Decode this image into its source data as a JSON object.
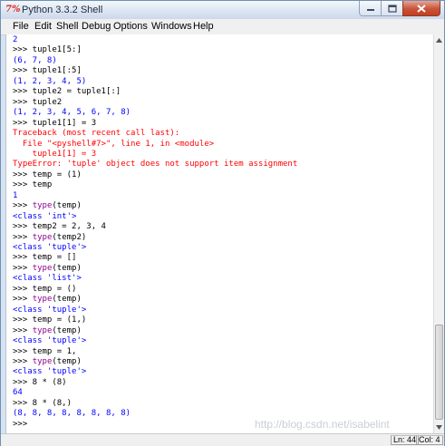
{
  "window": {
    "title": "Python 3.3.2 Shell",
    "icon": "python-idle-icon",
    "icon_glyph": "7%",
    "caption_buttons": [
      "minimize-icon",
      "maximize-icon",
      "close-icon"
    ]
  },
  "menu": [
    "File",
    "Edit",
    "Shell",
    "Debug",
    "Options",
    "Windows",
    "Help"
  ],
  "shell_lines": [
    {
      "text": "2",
      "kind": "out"
    },
    {
      "text": ">>> tuple1[5:]",
      "kind": "in"
    },
    {
      "text": "(6, 7, 8)",
      "kind": "out"
    },
    {
      "text": ">>> tuple1[:5]",
      "kind": "in"
    },
    {
      "text": "(1, 2, 3, 4, 5)",
      "kind": "out"
    },
    {
      "text": ">>> tuple2 = tuple1[:]",
      "kind": "in"
    },
    {
      "text": ">>> tuple2",
      "kind": "in"
    },
    {
      "text": "(1, 2, 3, 4, 5, 6, 7, 8)",
      "kind": "out"
    },
    {
      "text": ">>> tuple1[1] = 3",
      "kind": "in"
    },
    {
      "text": "Traceback (most recent call last):",
      "kind": "err"
    },
    {
      "text": "  File \"<pyshell#7>\", line 1, in <module>",
      "kind": "err"
    },
    {
      "text": "    tuple1[1] = 3",
      "kind": "err"
    },
    {
      "text": "TypeError: 'tuple' object does not support item assignment",
      "kind": "err"
    },
    {
      "text": ">>> temp = (1)",
      "kind": "in"
    },
    {
      "text": ">>> temp",
      "kind": "in"
    },
    {
      "text": "1",
      "kind": "out"
    },
    {
      "text": ">>> type(temp)",
      "kind": "in-kw"
    },
    {
      "text": "<class 'int'>",
      "kind": "out"
    },
    {
      "text": ">>> temp2 = 2, 3, 4",
      "kind": "in"
    },
    {
      "text": ">>> type(temp2)",
      "kind": "in-kw"
    },
    {
      "text": "<class 'tuple'>",
      "kind": "out"
    },
    {
      "text": ">>> temp = []",
      "kind": "in"
    },
    {
      "text": ">>> type(temp)",
      "kind": "in-kw"
    },
    {
      "text": "<class 'list'>",
      "kind": "out"
    },
    {
      "text": ">>> temp = ()",
      "kind": "in"
    },
    {
      "text": ">>> type(temp)",
      "kind": "in-kw"
    },
    {
      "text": "<class 'tuple'>",
      "kind": "out"
    },
    {
      "text": ">>> temp = (1,)",
      "kind": "in"
    },
    {
      "text": ">>> type(temp)",
      "kind": "in-kw"
    },
    {
      "text": "<class 'tuple'>",
      "kind": "out"
    },
    {
      "text": ">>> temp = 1,",
      "kind": "in"
    },
    {
      "text": ">>> type(temp)",
      "kind": "in-kw"
    },
    {
      "text": "<class 'tuple'>",
      "kind": "out"
    },
    {
      "text": ">>> 8 * (8)",
      "kind": "in"
    },
    {
      "text": "64",
      "kind": "out"
    },
    {
      "text": ">>> 8 * (8,)",
      "kind": "in"
    },
    {
      "text": "(8, 8, 8, 8, 8, 8, 8, 8)",
      "kind": "out"
    },
    {
      "text": ">>> ",
      "kind": "in"
    }
  ],
  "status": {
    "line": "Ln: 44",
    "col": "Col: 4"
  },
  "watermark": "http://blog.csdn.net/isabelint",
  "colors": {
    "output": "#0000ff",
    "error": "#ff0000",
    "builtin": "#900090",
    "prompt": "#000000"
  }
}
